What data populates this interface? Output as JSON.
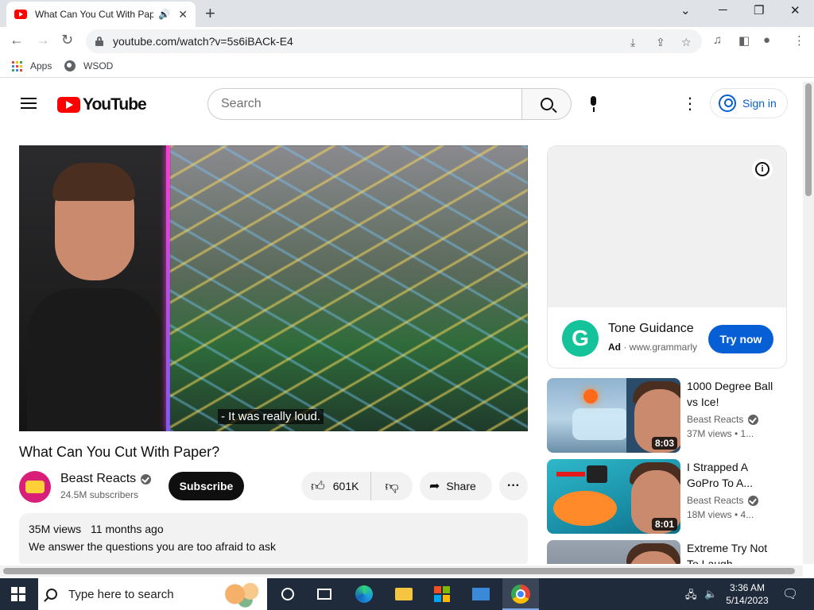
{
  "browser": {
    "tab_title": "What Can You Cut With Paper?",
    "url": "youtube.com/watch?v=5s6iBACk-E4",
    "bookmarks": [
      "Apps",
      "WSOD"
    ]
  },
  "youtube": {
    "logo_text": "YouTube",
    "search_placeholder": "Search",
    "signin_label": "Sign in"
  },
  "video": {
    "caption": "- It was really loud.",
    "title": "What Can You Cut With Paper?",
    "channel": "Beast Reacts",
    "subscribers": "24.5M subscribers",
    "subscribe_label": "Subscribe",
    "likes": "601K",
    "share_label": "Share",
    "views": "35M views",
    "age": "11 months ago",
    "description": "We answer the questions you are too afraid to ask"
  },
  "ad": {
    "title": "Tone Guidance",
    "badge": "Ad",
    "domain": "www.grammarly",
    "cta": "Try now",
    "logo_letter": "G"
  },
  "recommendations": [
    {
      "title": "1000 Degree Ball vs Ice!",
      "channel": "Beast Reacts",
      "meta": "37M views • 1...",
      "duration": "8:03"
    },
    {
      "title": "I Strapped A GoPro To A...",
      "channel": "Beast Reacts",
      "meta": "18M views • 4...",
      "duration": "8:01"
    },
    {
      "title": "Extreme Try Not To Laugh",
      "channel": "",
      "meta": "",
      "duration": ""
    }
  ],
  "taskbar": {
    "search_placeholder": "Type here to search",
    "time": "3:36 AM",
    "date": "5/14/2023"
  },
  "colors": {
    "youtube_red": "#ff0000",
    "link_blue": "#065fd4",
    "grammarly_green": "#15c39a"
  }
}
